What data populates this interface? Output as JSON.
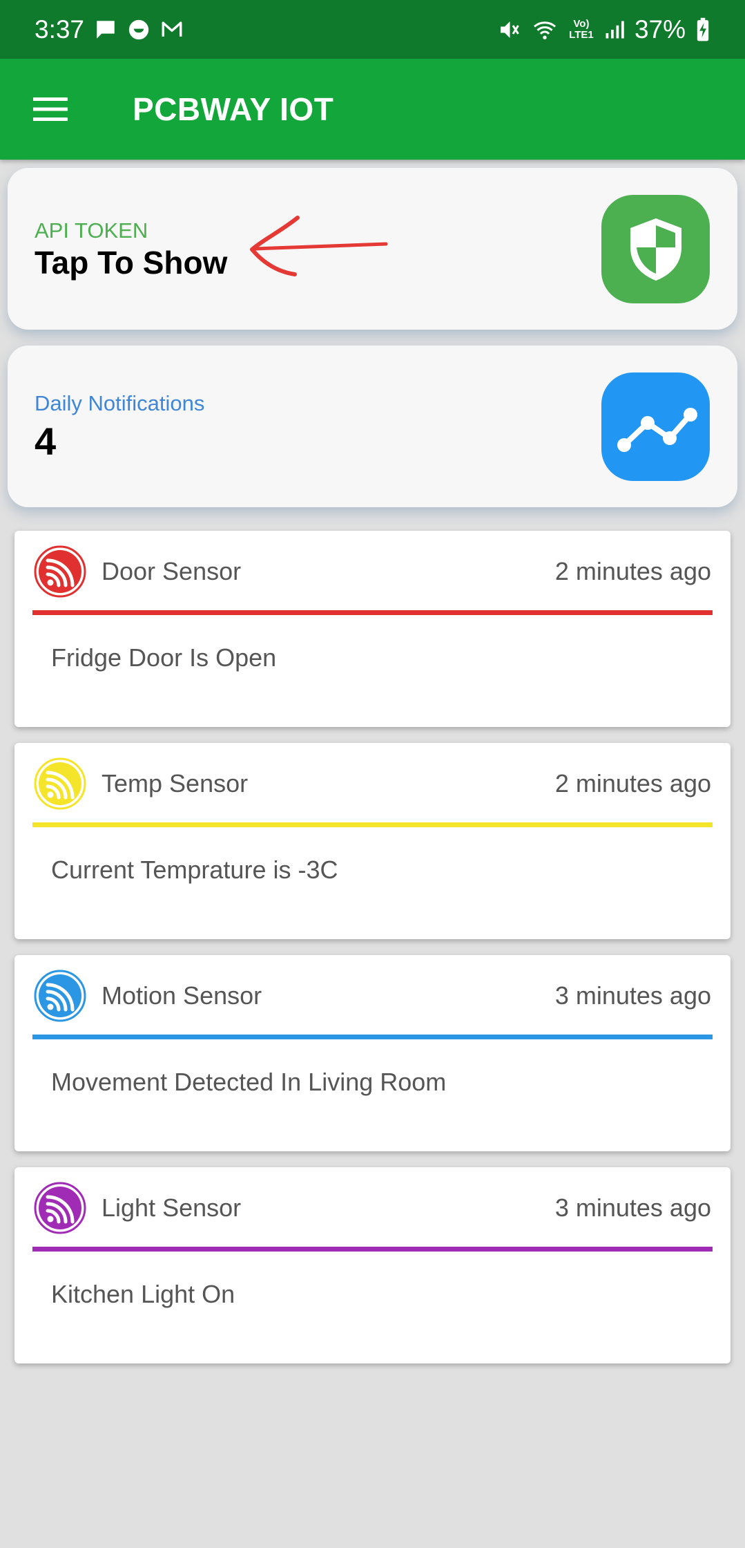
{
  "status_bar": {
    "time": "3:37",
    "battery_percent": "37%",
    "network_label": "Vo) LTE1",
    "left_icons": [
      "message-icon",
      "chat-bubble-icon",
      "gmail-icon"
    ],
    "right_icons": [
      "mute-icon",
      "wifi-icon",
      "signal-icon",
      "battery-charging-icon"
    ]
  },
  "app_bar": {
    "title": "PCBWAY IOT",
    "color": "#13a63a",
    "menu_icon": "hamburger-menu-icon"
  },
  "api_card": {
    "label": "API TOKEN",
    "value": "Tap To Show",
    "label_color": "#4caf50",
    "badge_color": "#4caf50",
    "icon": "shield-icon"
  },
  "notifications_card": {
    "label": "Daily Notifications",
    "value": "4",
    "label_color": "#3f87d6",
    "badge_color": "#2196f3",
    "icon": "trending-chart-icon"
  },
  "sensors": [
    {
      "name": "Door Sensor",
      "time": "2 minutes ago",
      "message": "Fridge Door Is Open",
      "color": "#e0302f",
      "icon": "espressif-logo-icon"
    },
    {
      "name": "Temp Sensor",
      "time": "2 minutes ago",
      "message": "Current Temprature is -3C",
      "color": "#f5e52a",
      "icon": "espressif-logo-icon"
    },
    {
      "name": "Motion Sensor",
      "time": "3 minutes ago",
      "message": "Movement Detected In Living Room",
      "color": "#2a96e4",
      "icon": "espressif-logo-icon"
    },
    {
      "name": "Light Sensor",
      "time": "3 minutes ago",
      "message": "Kitchen Light On",
      "color": "#a02cb5",
      "icon": "espressif-logo-icon"
    }
  ]
}
